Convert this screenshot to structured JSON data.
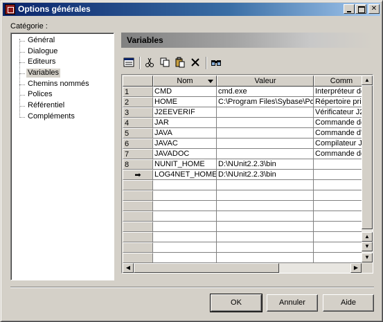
{
  "window": {
    "title": "Options générales"
  },
  "category": {
    "label": "Catégorie :"
  },
  "tree": {
    "items": [
      {
        "label": "Général",
        "selected": false
      },
      {
        "label": "Dialogue",
        "selected": false
      },
      {
        "label": "Editeurs",
        "selected": false
      },
      {
        "label": "Variables",
        "selected": true
      },
      {
        "label": "Chemins nommés",
        "selected": false
      },
      {
        "label": "Polices",
        "selected": false
      },
      {
        "label": "Référentiel",
        "selected": false
      },
      {
        "label": "Compléments",
        "selected": false
      }
    ]
  },
  "panel": {
    "title": "Variables"
  },
  "toolbar": {
    "icons": [
      "properties-icon",
      "cut-icon",
      "copy-icon",
      "paste-icon",
      "delete-icon",
      "find-icon"
    ]
  },
  "grid": {
    "columns": [
      "Nom",
      "Valeur",
      "Comm"
    ],
    "rows": [
      {
        "num": "1",
        "nom": "CMD",
        "valeur": "cmd.exe",
        "comm": "Interpréteur de"
      },
      {
        "num": "2",
        "nom": "HOME",
        "valeur": "C:\\Program Files\\Sybase\\Po",
        "comm": "Répertoire prin"
      },
      {
        "num": "3",
        "nom": "J2EEVERIF",
        "valeur": "",
        "comm": "Vérificateur J2I"
      },
      {
        "num": "4",
        "nom": "JAR",
        "valeur": "",
        "comm": "Commande de"
      },
      {
        "num": "5",
        "nom": "JAVA",
        "valeur": "",
        "comm": "Commande d'e"
      },
      {
        "num": "6",
        "nom": "JAVAC",
        "valeur": "",
        "comm": "Compilateur Jav"
      },
      {
        "num": "7",
        "nom": "JAVADOC",
        "valeur": "",
        "comm": "Commande de"
      },
      {
        "num": "8",
        "nom": "NUNIT_HOME",
        "valeur": "D:\\NUnit2.2.3\\bin",
        "comm": ""
      },
      {
        "num": "➡",
        "nom": "LOG4NET_HOME",
        "valeur": "D:\\NUnit2.2.3\\bin",
        "comm": ""
      }
    ],
    "empty_rows": 8
  },
  "buttons": {
    "ok": "OK",
    "annuler": "Annuler",
    "aide": "Aide"
  }
}
